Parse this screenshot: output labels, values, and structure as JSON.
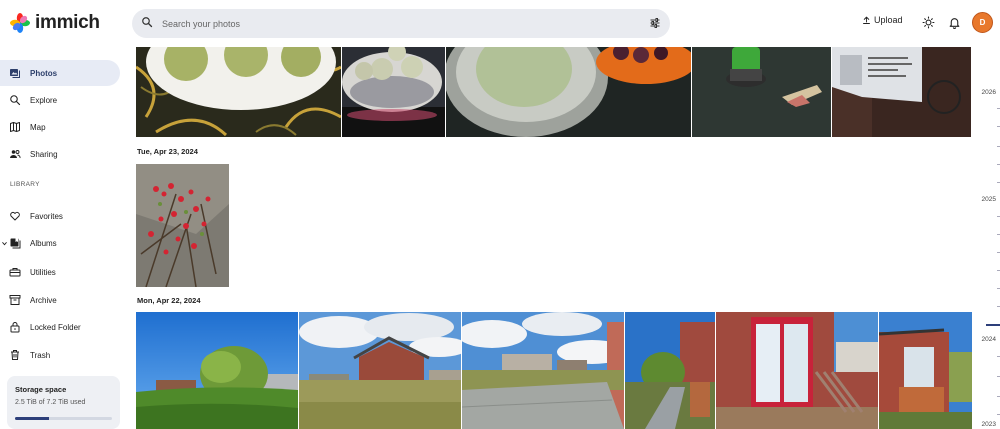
{
  "app": {
    "name": "immich"
  },
  "search": {
    "placeholder": "Search your photos"
  },
  "header": {
    "upload_label": "Upload",
    "avatar_initial": "D"
  },
  "sidebar": {
    "items": [
      {
        "label": "Photos",
        "icon": "photos-icon",
        "active": true
      },
      {
        "label": "Explore",
        "icon": "explore-icon"
      },
      {
        "label": "Map",
        "icon": "map-icon"
      },
      {
        "label": "Sharing",
        "icon": "sharing-icon"
      }
    ],
    "library_label": "LIBRARY",
    "library_items": [
      {
        "label": "Favorites",
        "icon": "heart-icon"
      },
      {
        "label": "Albums",
        "icon": "albums-icon"
      },
      {
        "label": "Utilities",
        "icon": "utilities-icon"
      },
      {
        "label": "Archive",
        "icon": "archive-icon"
      },
      {
        "label": "Locked Folder",
        "icon": "lock-icon"
      },
      {
        "label": "Trash",
        "icon": "trash-icon"
      }
    ]
  },
  "storage": {
    "title": "Storage space",
    "used_text": "2.5 TiB of 7.2 TiB used",
    "fraction": 0.35
  },
  "timeline": {
    "groups": [
      {
        "date": "Tue, Apr 23, 2024"
      },
      {
        "date": "Mon, Apr 22, 2024"
      }
    ]
  },
  "scrubber": {
    "years": [
      "2026",
      "2025",
      "2024",
      "2023"
    ]
  },
  "colors": {
    "accent": "#2d3f7a",
    "avatar": "#e8782c",
    "search_bg": "#e9ebf0"
  }
}
